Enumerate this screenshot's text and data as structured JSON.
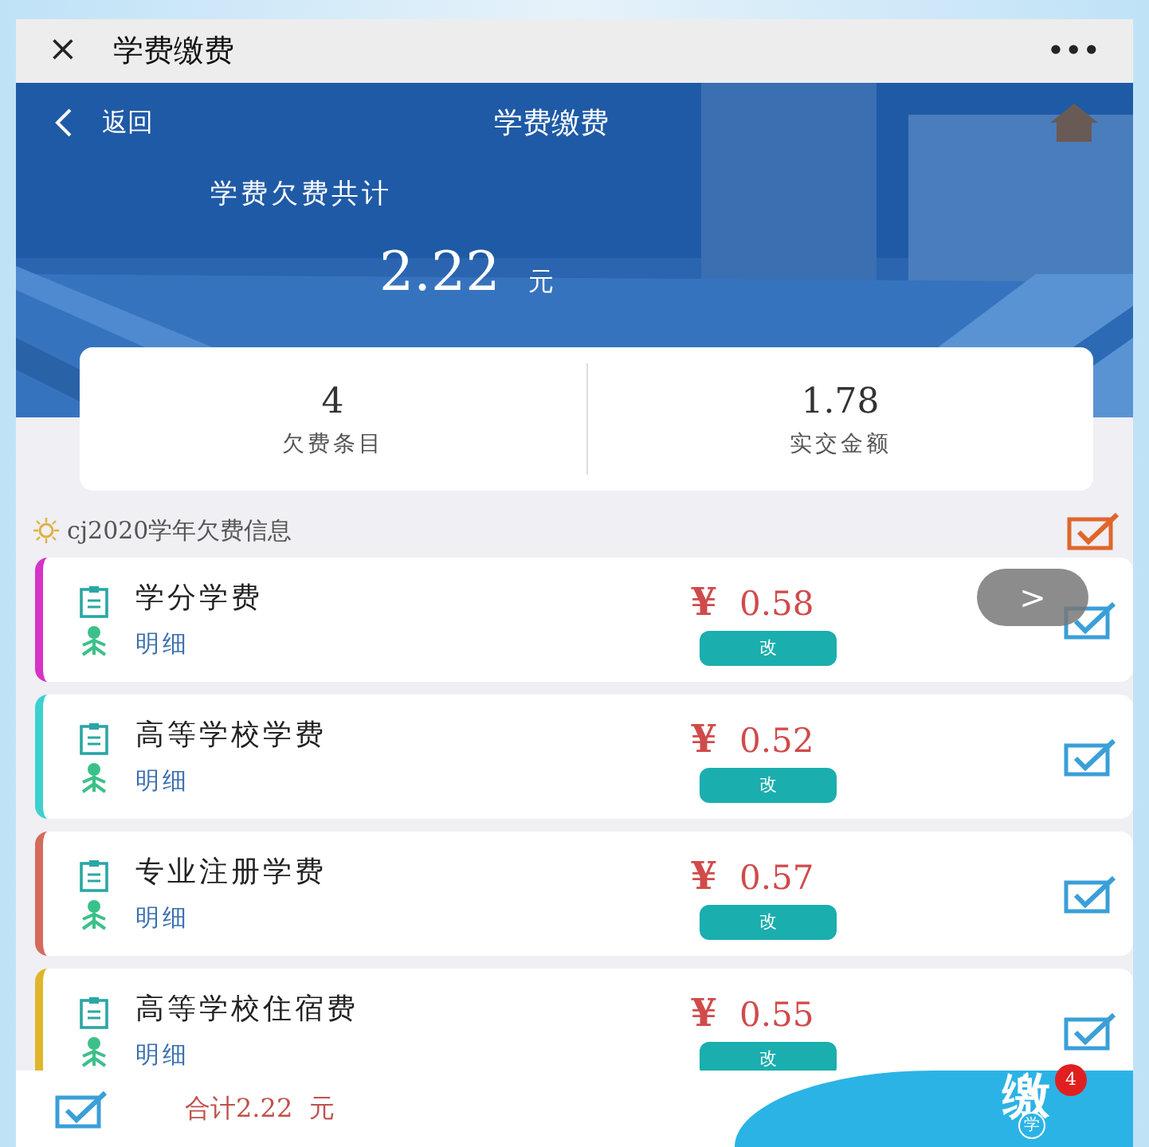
{
  "window": {
    "title": "学费缴费",
    "close": "×",
    "more": "•••"
  },
  "header": {
    "back": "返回",
    "title": "学费缴费",
    "total_label": "学费欠费共计",
    "total": "2.22",
    "unit": "元"
  },
  "stats": [
    {
      "value": "4",
      "label": "欠费条目"
    },
    {
      "value": "1.78",
      "label": "实交金额"
    }
  ],
  "section": {
    "title": "cj2020学年欠费信息",
    "checked": true
  },
  "items": [
    {
      "name": "学分学费",
      "detail": "明细",
      "currency": "¥",
      "amount": "0.58",
      "action": "改",
      "color": "#d633c8",
      "checked": true
    },
    {
      "name": "高等学校学费",
      "detail": "明细",
      "currency": "¥",
      "amount": "0.52",
      "action": "改",
      "color": "#3dd0cf",
      "checked": true
    },
    {
      "name": "专业注册学费",
      "detail": "明细",
      "currency": "¥",
      "amount": "0.57",
      "action": "改",
      "color": "#d66a5e",
      "checked": true
    },
    {
      "name": "高等学校住宿费",
      "detail": "明细",
      "currency": "¥",
      "amount": "0.55",
      "action": "改",
      "color": "#e0b52a",
      "checked": true
    }
  ],
  "float_button": {
    "label": ">"
  },
  "footer": {
    "checked": true,
    "total": "合计2.22  元",
    "pay": "缴",
    "pay_sub": "学",
    "badge": "4"
  }
}
